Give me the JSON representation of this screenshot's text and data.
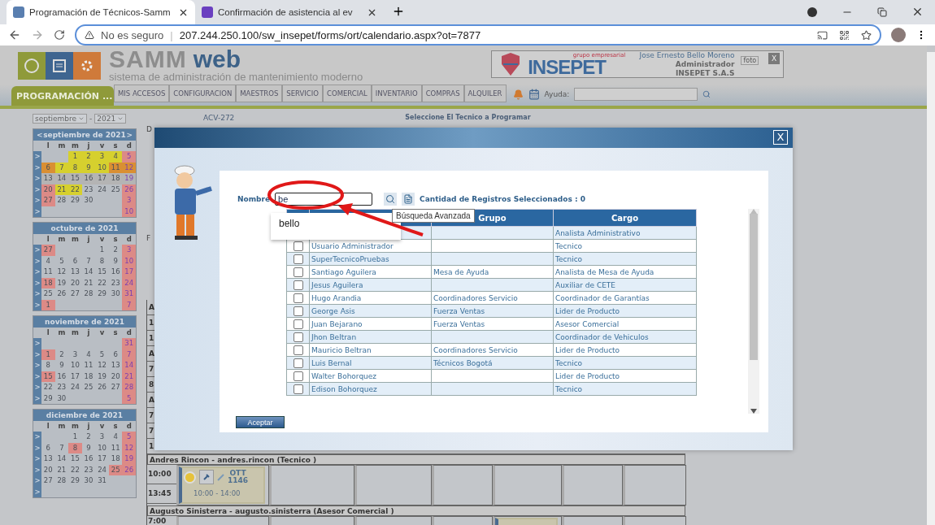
{
  "browser": {
    "tabs": [
      {
        "title": "Programación de Técnicos-Samm",
        "selected": true
      },
      {
        "title": "Confirmación de asistencia al ev",
        "selected": false
      }
    ],
    "security": "No es seguro",
    "separator": "|",
    "url": "207.244.250.100/sw_insepet/forms/ort/calendario.aspx?ot=7877"
  },
  "header": {
    "brand_a": "SAMM",
    "brand_b": "web",
    "subtitle": "sistema de administración de mantenimiento moderno",
    "company_tag": "grupo empresarial",
    "company": "INSEPET",
    "user": "Jose Ernesto Bello Moreno",
    "role": "Administrador",
    "org": "INSEPET S.A.S",
    "photo_alt": "foto",
    "close": "X"
  },
  "nav": {
    "section": "PROGRAMACIÓN ...",
    "items": [
      "MIS ACCESOS",
      "CONFIGURACION",
      "MAESTROS",
      "SERVICIO",
      "COMERCIAL",
      "INVENTARIO",
      "COMPRAS",
      "ALQUILER"
    ],
    "help_label": "Ayuda:"
  },
  "sidebar": {
    "month_select": "septiembre",
    "separator": "-",
    "year_select": "2021",
    "months": [
      {
        "title": "septiembre de 2021",
        "prev": "<",
        "next": ">",
        "weekdays": [
          "l",
          "m",
          "m",
          "j",
          "v",
          "s",
          "d"
        ],
        "weeks": [
          {
            "arrow": ">",
            "days": [
              {
                "kind": "blank"
              },
              {
                "kind": "blank"
              },
              {
                "kind": "day",
                "day": "1",
                "color": "#d6d02e"
              },
              {
                "kind": "day",
                "day": "2",
                "color": "#d6d02e"
              },
              {
                "kind": "day",
                "day": "3",
                "color": "#d6d02e"
              },
              {
                "kind": "day",
                "day": "4",
                "color": "#d6d02e"
              },
              {
                "kind": "day",
                "day": "5",
                "color": "#dc8a86"
              }
            ]
          },
          {
            "arrow": ">",
            "days": [
              {
                "kind": "day",
                "day": "6",
                "color": "#d98f33"
              },
              {
                "kind": "day",
                "day": "7",
                "color": "#d6d02e"
              },
              {
                "kind": "day",
                "day": "8",
                "color": "#d6d02e"
              },
              {
                "kind": "day",
                "day": "9",
                "color": "#d6d02e"
              },
              {
                "kind": "day",
                "day": "10",
                "color": "#d6d02e"
              },
              {
                "kind": "day",
                "day": "11",
                "color": "#d98f33"
              },
              {
                "kind": "day",
                "day": "12",
                "color": "#d98f33"
              }
            ]
          },
          {
            "arrow": ">",
            "days": [
              {
                "kind": "day",
                "day": "13",
                "color": "#b4b4b4"
              },
              {
                "kind": "day",
                "day": "14",
                "color": "#b4b4b4"
              },
              {
                "kind": "day",
                "day": "15",
                "color": "#b4b4b4"
              },
              {
                "kind": "day",
                "day": "16",
                "color": "#b4b4b4"
              },
              {
                "kind": "day",
                "day": "17",
                "color": "#b4b4b4"
              },
              {
                "kind": "day",
                "day": "18",
                "color": "#b4b4b4"
              },
              {
                "kind": "day",
                "day": "19",
                "color": "#b4b4b4"
              }
            ]
          },
          {
            "arrow": ">",
            "days": [
              {
                "kind": "day",
                "day": "20",
                "color": "#dc8a86"
              },
              {
                "kind": "day",
                "day": "21",
                "color": "#d6d02e"
              },
              {
                "kind": "day",
                "day": "22",
                "color": "#d6d02e"
              },
              {
                "kind": "day",
                "day": "23"
              },
              {
                "kind": "day",
                "day": "24"
              },
              {
                "kind": "day",
                "day": "25"
              },
              {
                "kind": "day",
                "day": "26",
                "color": "#dc8a86"
              }
            ]
          },
          {
            "arrow": ">",
            "days": [
              {
                "kind": "day",
                "day": "27",
                "color": "#dc8a86"
              },
              {
                "kind": "day",
                "day": "28"
              },
              {
                "kind": "day",
                "day": "29"
              },
              {
                "kind": "day",
                "day": "30"
              },
              {
                "kind": "blank"
              },
              {
                "kind": "blank"
              },
              {
                "kind": "day",
                "day": "3",
                "color": "#dc8a86"
              }
            ]
          },
          {
            "arrow": ">",
            "days": [
              {
                "kind": "blank"
              },
              {
                "kind": "blank"
              },
              {
                "kind": "blank"
              },
              {
                "kind": "blank"
              },
              {
                "kind": "blank"
              },
              {
                "kind": "blank"
              },
              {
                "kind": "day",
                "day": "10",
                "color": "#dc8a86"
              }
            ]
          }
        ]
      },
      {
        "title": "octubre de 2021",
        "weekdays": [
          "l",
          "m",
          "m",
          "j",
          "v",
          "s",
          "d"
        ],
        "weeks": [
          {
            "arrow": ">",
            "days": [
              {
                "kind": "day",
                "day": "27",
                "color": "#dc8a86"
              },
              {
                "kind": "blank"
              },
              {
                "kind": "blank"
              },
              {
                "kind": "blank"
              },
              {
                "kind": "day",
                "day": "1"
              },
              {
                "kind": "day",
                "day": "2"
              },
              {
                "kind": "day",
                "day": "3",
                "color": "#dc8a86"
              }
            ]
          },
          {
            "arrow": ">",
            "days": [
              {
                "kind": "day",
                "day": "4"
              },
              {
                "kind": "day",
                "day": "5"
              },
              {
                "kind": "day",
                "day": "6"
              },
              {
                "kind": "day",
                "day": "7"
              },
              {
                "kind": "day",
                "day": "8"
              },
              {
                "kind": "day",
                "day": "9"
              },
              {
                "kind": "day",
                "day": "10",
                "color": "#dc8a86"
              }
            ]
          },
          {
            "arrow": ">",
            "days": [
              {
                "kind": "day",
                "day": "11"
              },
              {
                "kind": "day",
                "day": "12"
              },
              {
                "kind": "day",
                "day": "13"
              },
              {
                "kind": "day",
                "day": "14"
              },
              {
                "kind": "day",
                "day": "15"
              },
              {
                "kind": "day",
                "day": "16"
              },
              {
                "kind": "day",
                "day": "17",
                "color": "#dc8a86"
              }
            ]
          },
          {
            "arrow": ">",
            "days": [
              {
                "kind": "day",
                "day": "18",
                "color": "#dc8a86"
              },
              {
                "kind": "day",
                "day": "19"
              },
              {
                "kind": "day",
                "day": "20"
              },
              {
                "kind": "day",
                "day": "21"
              },
              {
                "kind": "day",
                "day": "22"
              },
              {
                "kind": "day",
                "day": "23"
              },
              {
                "kind": "day",
                "day": "24",
                "color": "#dc8a86"
              }
            ]
          },
          {
            "arrow": ">",
            "days": [
              {
                "kind": "day",
                "day": "25"
              },
              {
                "kind": "day",
                "day": "26"
              },
              {
                "kind": "day",
                "day": "27"
              },
              {
                "kind": "day",
                "day": "28"
              },
              {
                "kind": "day",
                "day": "29"
              },
              {
                "kind": "day",
                "day": "30"
              },
              {
                "kind": "day",
                "day": "31",
                "color": "#dc8a86"
              }
            ]
          },
          {
            "arrow": ">",
            "days": [
              {
                "kind": "day",
                "day": "1",
                "color": "#dc8a86"
              },
              {
                "kind": "blank"
              },
              {
                "kind": "blank"
              },
              {
                "kind": "blank"
              },
              {
                "kind": "blank"
              },
              {
                "kind": "blank"
              },
              {
                "kind": "day",
                "day": "7",
                "color": "#dc8a86"
              }
            ]
          }
        ]
      },
      {
        "title": "noviembre de 2021",
        "weekdays": [
          "l",
          "m",
          "m",
          "j",
          "v",
          "s",
          "d"
        ],
        "weeks": [
          {
            "arrow": ">",
            "days": [
              {
                "kind": "blank"
              },
              {
                "kind": "blank"
              },
              {
                "kind": "blank"
              },
              {
                "kind": "blank"
              },
              {
                "kind": "blank"
              },
              {
                "kind": "blank"
              },
              {
                "kind": "day",
                "day": "31",
                "color": "#dc8a86"
              }
            ]
          },
          {
            "arrow": ">",
            "days": [
              {
                "kind": "day",
                "day": "1",
                "color": "#dc8a86"
              },
              {
                "kind": "day",
                "day": "2"
              },
              {
                "kind": "day",
                "day": "3"
              },
              {
                "kind": "day",
                "day": "4"
              },
              {
                "kind": "day",
                "day": "5"
              },
              {
                "kind": "day",
                "day": "6"
              },
              {
                "kind": "day",
                "day": "7",
                "color": "#dc8a86"
              }
            ]
          },
          {
            "arrow": ">",
            "days": [
              {
                "kind": "day",
                "day": "8"
              },
              {
                "kind": "day",
                "day": "9"
              },
              {
                "kind": "day",
                "day": "10"
              },
              {
                "kind": "day",
                "day": "11"
              },
              {
                "kind": "day",
                "day": "12"
              },
              {
                "kind": "day",
                "day": "13"
              },
              {
                "kind": "day",
                "day": "14",
                "color": "#dc8a86"
              }
            ]
          },
          {
            "arrow": ">",
            "days": [
              {
                "kind": "day",
                "day": "15",
                "color": "#dc8a86"
              },
              {
                "kind": "day",
                "day": "16"
              },
              {
                "kind": "day",
                "day": "17"
              },
              {
                "kind": "day",
                "day": "18"
              },
              {
                "kind": "day",
                "day": "19"
              },
              {
                "kind": "day",
                "day": "20"
              },
              {
                "kind": "day",
                "day": "21",
                "color": "#dc8a86"
              }
            ]
          },
          {
            "arrow": ">",
            "days": [
              {
                "kind": "day",
                "day": "22"
              },
              {
                "kind": "day",
                "day": "23"
              },
              {
                "kind": "day",
                "day": "24"
              },
              {
                "kind": "day",
                "day": "25"
              },
              {
                "kind": "day",
                "day": "26"
              },
              {
                "kind": "day",
                "day": "27"
              },
              {
                "kind": "day",
                "day": "28",
                "color": "#dc8a86"
              }
            ]
          },
          {
            "arrow": ">",
            "days": [
              {
                "kind": "day",
                "day": "29"
              },
              {
                "kind": "day",
                "day": "30"
              },
              {
                "kind": "blank"
              },
              {
                "kind": "blank"
              },
              {
                "kind": "blank"
              },
              {
                "kind": "blank"
              },
              {
                "kind": "day",
                "day": "5",
                "color": "#dc8a86"
              }
            ]
          }
        ]
      },
      {
        "title": "diciembre de 2021",
        "weekdays": [
          "l",
          "m",
          "m",
          "j",
          "v",
          "s",
          "d"
        ],
        "weeks": [
          {
            "arrow": ">",
            "days": [
              {
                "kind": "blank"
              },
              {
                "kind": "blank"
              },
              {
                "kind": "day",
                "day": "1"
              },
              {
                "kind": "day",
                "day": "2"
              },
              {
                "kind": "day",
                "day": "3"
              },
              {
                "kind": "day",
                "day": "4"
              },
              {
                "kind": "day",
                "day": "5",
                "color": "#dc8a86"
              }
            ]
          },
          {
            "arrow": ">",
            "days": [
              {
                "kind": "day",
                "day": "6"
              },
              {
                "kind": "day",
                "day": "7"
              },
              {
                "kind": "day",
                "day": "8",
                "color": "#dc8a86"
              },
              {
                "kind": "day",
                "day": "9"
              },
              {
                "kind": "day",
                "day": "10"
              },
              {
                "kind": "day",
                "day": "11"
              },
              {
                "kind": "day",
                "day": "12",
                "color": "#dc8a86"
              }
            ]
          },
          {
            "arrow": ">",
            "days": [
              {
                "kind": "day",
                "day": "13"
              },
              {
                "kind": "day",
                "day": "14"
              },
              {
                "kind": "day",
                "day": "15"
              },
              {
                "kind": "day",
                "day": "16"
              },
              {
                "kind": "day",
                "day": "17"
              },
              {
                "kind": "day",
                "day": "18"
              },
              {
                "kind": "day",
                "day": "19",
                "color": "#dc8a86"
              }
            ]
          },
          {
            "arrow": ">",
            "days": [
              {
                "kind": "day",
                "day": "20"
              },
              {
                "kind": "day",
                "day": "21"
              },
              {
                "kind": "day",
                "day": "22"
              },
              {
                "kind": "day",
                "day": "23"
              },
              {
                "kind": "day",
                "day": "24"
              },
              {
                "kind": "day",
                "day": "25",
                "color": "#dc8a86"
              },
              {
                "kind": "day",
                "day": "26",
                "color": "#dc8a86"
              }
            ]
          },
          {
            "arrow": ">",
            "days": [
              {
                "kind": "day",
                "day": "27"
              },
              {
                "kind": "day",
                "day": "28"
              },
              {
                "kind": "day",
                "day": "29"
              },
              {
                "kind": "day",
                "day": "30"
              },
              {
                "kind": "day",
                "day": "31"
              },
              {
                "kind": "blank"
              },
              {
                "kind": "blank"
              }
            ]
          },
          {
            "arrow": ">",
            "days": [
              {
                "kind": "blank"
              },
              {
                "kind": "blank"
              },
              {
                "kind": "blank"
              },
              {
                "kind": "blank"
              },
              {
                "kind": "blank"
              },
              {
                "kind": "blank"
              },
              {
                "kind": "blank"
              }
            ]
          }
        ]
      }
    ]
  },
  "main": {
    "code": "ACV-272",
    "heading": "Seleccione El Tecnico a Programar",
    "fragments": [
      "D",
      "F"
    ],
    "schedule": [
      {
        "kind": "fragment",
        "text": "A"
      },
      {
        "kind": "fragment",
        "text": "1"
      },
      {
        "kind": "fragment",
        "text": "1"
      },
      {
        "kind": "fragment",
        "text": "A"
      },
      {
        "kind": "fragment",
        "text": "7"
      },
      {
        "kind": "fragment",
        "text": "8"
      },
      {
        "kind": "fragment",
        "text": "A"
      },
      {
        "kind": "fragment",
        "text": "7"
      },
      {
        "kind": "fragment",
        "text": "7"
      },
      {
        "kind": "fragment",
        "text": "1"
      },
      {
        "kind": "person",
        "text": "Andres Rincon - andres.rincon (Tecnico )"
      },
      {
        "kind": "slot",
        "times": [
          "10:00",
          "13:45"
        ],
        "cells": [
          {
            "booked": true,
            "code": "OTT",
            "number": "1146",
            "time": "10:00 - 14:00"
          },
          {
            "booked": false
          },
          {
            "booked": false
          },
          {
            "booked": false
          },
          {
            "booked": false
          },
          {
            "booked": false
          },
          {
            "booked": false
          }
        ]
      },
      {
        "kind": "person",
        "text": "Augusto Sinisterra - augusto.sinisterra (Asesor Comercial )"
      },
      {
        "kind": "slot",
        "times": [
          "7:00"
        ],
        "cells": [
          {
            "booked": false
          },
          {
            "booked": false
          },
          {
            "booked": false
          },
          {
            "booked": false
          },
          {
            "booked": true
          },
          {
            "booked": false
          },
          {
            "booked": false
          }
        ]
      }
    ]
  },
  "dialog": {
    "close": "X",
    "name_label": "Nombre",
    "name_value": "be",
    "suggestions": [
      "bello"
    ],
    "selected_count": "Cantidad de Registros Seleccionados : 0",
    "tooltip": "Búsqueda Avanzada",
    "columns": [
      "Grupo",
      "Cargo"
    ],
    "rows": [
      {
        "role": "Analista Administrativo"
      },
      {
        "name": "Usuario Administrador",
        "role": "Tecnico",
        "checked": false
      },
      {
        "name": "SuperTecnicoPruebas",
        "role": "Tecnico",
        "checked": false
      },
      {
        "name": "Santiago Aguilera",
        "group": "Mesa de Ayuda",
        "role": "Analista de Mesa de Ayuda",
        "checked": false
      },
      {
        "name": "Jesus Aguilera",
        "role": "Auxiliar de CETE",
        "checked": false
      },
      {
        "name": "Hugo Arandia",
        "group": "Coordinadores Servicio",
        "role": "Coordinador de Garantías",
        "checked": false
      },
      {
        "name": "George Asis",
        "group": "Fuerza Ventas",
        "role": "Lider de Producto",
        "checked": false
      },
      {
        "name": "Juan Bejarano",
        "group": "Fuerza Ventas",
        "role": "Asesor Comercial",
        "checked": false
      },
      {
        "name": "Jhon Beltran",
        "role": "Coordinador de Vehiculos",
        "checked": false
      },
      {
        "name": "Mauricio Beltran",
        "group": "Coordinadores Servicio",
        "role": "Lider de Producto",
        "checked": false
      },
      {
        "name": "Luis Bernal",
        "group": "Técnicos Bogotá",
        "role": "Tecnico",
        "checked": false
      },
      {
        "name": "Walter Bohorquez",
        "role": "Lider de Producto",
        "checked": false
      },
      {
        "name": "Edison Bohorquez",
        "role": "Tecnico",
        "checked": false
      }
    ],
    "accept": "Aceptar"
  }
}
